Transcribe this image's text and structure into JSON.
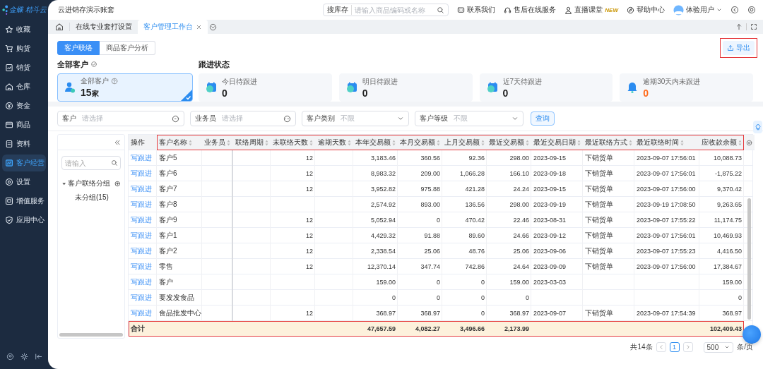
{
  "sidebar": {
    "logo": "金蝶 精斗云",
    "items": [
      {
        "label": "收藏",
        "selected": false
      },
      {
        "label": "购货",
        "selected": false
      },
      {
        "label": "销货",
        "selected": false
      },
      {
        "label": "仓库",
        "selected": false
      },
      {
        "label": "资金",
        "selected": false
      },
      {
        "label": "商品",
        "selected": false
      },
      {
        "label": "资料",
        "selected": false
      },
      {
        "label": "客户经营",
        "selected": true
      },
      {
        "label": "设置",
        "selected": false
      },
      {
        "label": "增值服务",
        "selected": false
      },
      {
        "label": "应用中心",
        "selected": false
      }
    ]
  },
  "topbar": {
    "title": "云进销存演示账套",
    "search": {
      "scope": "搜库存",
      "placeholder": "请输入商品编码或名称"
    },
    "links": [
      {
        "label": "联系我们"
      },
      {
        "label": "售后在线服务"
      },
      {
        "label": "直播课堂",
        "badge": "NEW"
      },
      {
        "label": "帮助中心"
      }
    ],
    "user": "体验用户"
  },
  "tabs": [
    {
      "label": "在线专业套打设置",
      "selected": false
    },
    {
      "label": "客户管理工作台",
      "selected": true
    }
  ],
  "view_tabs": [
    {
      "label": "客户联络",
      "selected": true
    },
    {
      "label": "商品客户分析",
      "selected": false
    }
  ],
  "export_button": {
    "label": "导出",
    "highlighted": true
  },
  "all_customers": {
    "heading": "全部客户",
    "card": {
      "label": "全部客户",
      "value": "15",
      "unit": "家",
      "selected": true
    }
  },
  "follow_up": {
    "heading": "跟进状态",
    "cards": [
      {
        "label": "今日待跟进",
        "value": "0",
        "kind": "calendar",
        "selected": false,
        "alert": false
      },
      {
        "label": "明日待跟进",
        "value": "0",
        "kind": "calendar",
        "selected": false,
        "alert": false
      },
      {
        "label": "近7天待跟进",
        "value": "0",
        "kind": "calendar",
        "selected": false,
        "alert": false
      },
      {
        "label": "逾期30天内未跟进",
        "value": "0",
        "kind": "bell",
        "selected": false,
        "alert": true
      }
    ]
  },
  "filters": [
    {
      "label": "客户",
      "placeholder": "请选择",
      "kind": "picker"
    },
    {
      "label": "业务员",
      "placeholder": "请选择",
      "kind": "picker"
    },
    {
      "label": "客户类别",
      "placeholder": "不限",
      "kind": "select"
    },
    {
      "label": "客户等级",
      "placeholder": "不限",
      "kind": "select"
    }
  ],
  "query_button": "查询",
  "groups": {
    "search_placeholder": "请输入",
    "tree": [
      {
        "label": "客户联络分组",
        "expanded": true,
        "children": [
          {
            "label": "未分组(15)"
          }
        ]
      }
    ]
  },
  "table": {
    "header_highlighted": true,
    "columns": [
      {
        "label": "操作",
        "kind": "link",
        "sortable": false
      },
      {
        "label": "客户名称",
        "kind": "text",
        "sortable": true
      },
      {
        "label": "业务员",
        "kind": "text",
        "sortable": true
      },
      {
        "label": "联络周期",
        "kind": "text",
        "sortable": true
      },
      {
        "label": "未联络天数",
        "kind": "number",
        "sortable": true
      },
      {
        "label": "逾期天数",
        "kind": "number",
        "sortable": true
      },
      {
        "label": "本年交易额",
        "kind": "number",
        "sortable": true
      },
      {
        "label": "本月交易额",
        "kind": "number",
        "sortable": true
      },
      {
        "label": "上月交易额",
        "kind": "number",
        "sortable": true
      },
      {
        "label": "最近交易额",
        "kind": "number",
        "sortable": true
      },
      {
        "label": "最近交易日期",
        "kind": "text",
        "sortable": true
      },
      {
        "label": "最近联络方式",
        "kind": "text",
        "sortable": true
      },
      {
        "label": "最近联络时间",
        "kind": "text",
        "sortable": true
      },
      {
        "label": "应收款余额",
        "kind": "number",
        "sortable": true
      }
    ],
    "rows": [
      [
        "写跟进",
        "客户5",
        null,
        null,
        "12",
        null,
        "3,183.46",
        "360.56",
        "92.36",
        "298.00",
        "2023-09-15",
        "下销货单",
        "2023-09-07 17:56:01",
        "10,088.73"
      ],
      [
        "写跟进",
        "客户6",
        null,
        null,
        "12",
        null,
        "8,983.32",
        "209.00",
        "1,066.28",
        "166.10",
        "2023-09-18",
        "下销货单",
        "2023-09-07 17:56:01",
        "-1,875.22"
      ],
      [
        "写跟进",
        "客户7",
        null,
        null,
        "12",
        null,
        "3,952.82",
        "975.88",
        "421.28",
        "24.24",
        "2023-09-15",
        "下销货单",
        "2023-09-07 17:56:00",
        "9,370.42"
      ],
      [
        "写跟进",
        "客户8",
        null,
        null,
        null,
        null,
        "2,574.92",
        "893.00",
        "136.56",
        "298.00",
        "2023-09-19",
        "下销货单",
        "2023-09-19 17:08:50",
        "9,263.65"
      ],
      [
        "写跟进",
        "客户9",
        null,
        null,
        "12",
        null,
        "5,052.94",
        "0",
        "470.42",
        "22.46",
        "2023-08-31",
        "下销货单",
        "2023-09-07 17:55:22",
        "11,174.75"
      ],
      [
        "写跟进",
        "客户1",
        null,
        null,
        "12",
        null,
        "4,429.32",
        "91.88",
        "89.60",
        "24.66",
        "2023-09-12",
        "下销货单",
        "2023-09-07 17:56:01",
        "10,469.93"
      ],
      [
        "写跟进",
        "客户2",
        null,
        null,
        "12",
        null,
        "2,338.54",
        "25.06",
        "48.76",
        "25.06",
        "2023-09-06",
        "下销货单",
        "2023-09-07 17:55:23",
        "4,416.50"
      ],
      [
        "写跟进",
        "零售",
        null,
        null,
        "12",
        null,
        "12,370.14",
        "347.74",
        "742.86",
        "24.64",
        "2023-09-09",
        "下销货单",
        "2023-09-07 17:56:00",
        "17,384.67"
      ],
      [
        "写跟进",
        "客户",
        null,
        null,
        null,
        null,
        "159.00",
        "0",
        "0",
        "159.00",
        "2023-03-03",
        null,
        null,
        "159.00"
      ],
      [
        "写跟进",
        "要发发食品",
        null,
        null,
        null,
        null,
        "0",
        "0",
        "0",
        "0",
        null,
        null,
        null,
        "0"
      ],
      [
        "写跟进",
        "食品批发中心",
        null,
        null,
        "12",
        null,
        "368.97",
        "368.97",
        "0",
        "368.97",
        "2023-09-07",
        "下销货单",
        "2023-09-07 17:54:39",
        "368.97"
      ]
    ],
    "total": {
      "highlighted": true,
      "cells": [
        "合计",
        null,
        null,
        null,
        null,
        null,
        "47,657.59",
        "4,082.27",
        "3,496.66",
        "2,173.99",
        null,
        null,
        null,
        "102,409.43"
      ]
    }
  },
  "pager": {
    "total": "共14条",
    "pages": [
      {
        "label": "1",
        "selected": true
      }
    ],
    "page_size": "500",
    "unit": "条/页"
  }
}
